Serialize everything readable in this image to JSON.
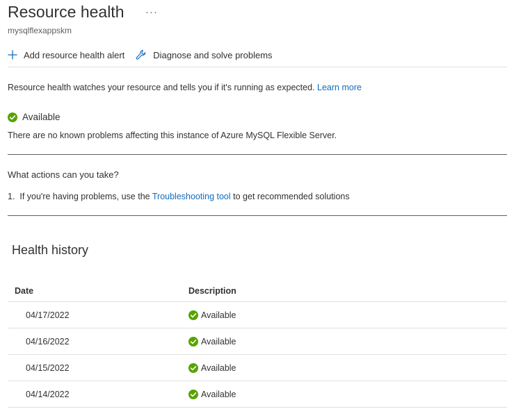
{
  "header": {
    "title": "Resource health",
    "more_label": "···",
    "subtitle": "mysqlflexappskm"
  },
  "toolbar": {
    "add_alert_label": "Add resource health alert",
    "diagnose_label": "Diagnose and solve problems"
  },
  "intro": {
    "text": "Resource health watches your resource and tells you if it's running as expected.",
    "link_label": "Learn more"
  },
  "status": {
    "label": "Available",
    "description": "There are no known problems affecting this instance of Azure MySQL Flexible Server.",
    "icon": "check-circle-icon",
    "color": "#57a300"
  },
  "actions": {
    "heading": "What actions can you take?",
    "items": [
      {
        "number": "1.",
        "prefix": "If you're having problems, use the",
        "link_label": "Troubleshooting tool",
        "suffix": "to get recommended solutions"
      }
    ]
  },
  "history": {
    "title": "Health history",
    "columns": [
      "Date",
      "Description"
    ],
    "rows": [
      {
        "date": "04/17/2022",
        "description": "Available"
      },
      {
        "date": "04/16/2022",
        "description": "Available"
      },
      {
        "date": "04/15/2022",
        "description": "Available"
      },
      {
        "date": "04/14/2022",
        "description": "Available"
      }
    ]
  },
  "colors": {
    "accent": "#0f6cbd",
    "success": "#57a300",
    "text": "#323130"
  }
}
